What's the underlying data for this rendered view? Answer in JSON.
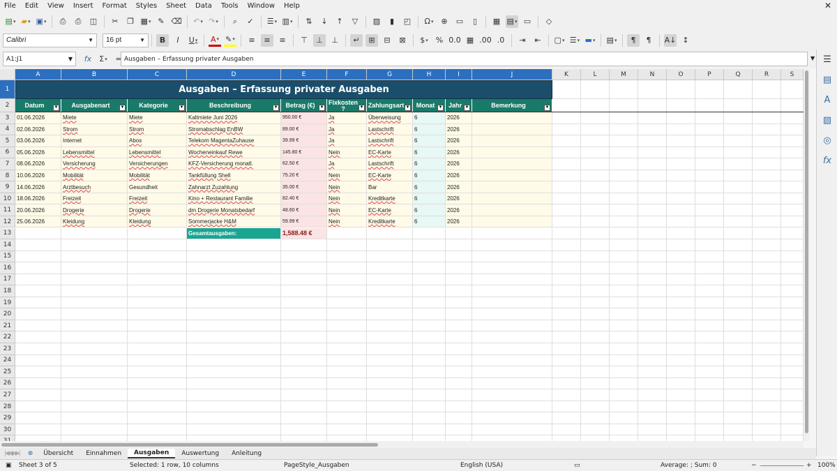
{
  "menu": [
    "File",
    "Edit",
    "View",
    "Insert",
    "Format",
    "Styles",
    "Sheet",
    "Data",
    "Tools",
    "Window",
    "Help"
  ],
  "font": {
    "name": "Calibri",
    "size": "16 pt"
  },
  "namebox": "A1:J1",
  "formula": "Ausgaben – Erfassung privater Ausgaben",
  "columns": [
    "A",
    "B",
    "C",
    "D",
    "E",
    "F",
    "G",
    "H",
    "I",
    "J",
    "K",
    "L",
    "M",
    "N",
    "O",
    "P",
    "Q",
    "R",
    "S"
  ],
  "title": "Ausgaben – Erfassung privater Ausgaben",
  "headers": [
    "Datum",
    "Ausgabenart",
    "Kategorie",
    "Beschreibung",
    "Betrag (€)",
    "Fixkosten ?",
    "Zahlungsart",
    "Monat",
    "Jahr",
    "Bemerkung"
  ],
  "rows": [
    [
      "01.06.2026",
      "Miete",
      "Miete",
      "Kaltmiete Juni 2026",
      "950.00 €",
      "Ja",
      "Überweisung",
      "6",
      "2026",
      ""
    ],
    [
      "02.06.2026",
      "Strom",
      "Strom",
      "Stromabschlag EnBW",
      "89.00 €",
      "Ja",
      "Lastschrift",
      "6",
      "2026",
      ""
    ],
    [
      "03.06.2026",
      "Internet",
      "Abos",
      "Telekom MagentaZuhause",
      "39.99 €",
      "Ja",
      "Lastschrift",
      "6",
      "2026",
      ""
    ],
    [
      "05.06.2026",
      "Lebensmittel",
      "Lebensmittel",
      "Wocheneinkauf Rewe",
      "145.80 €",
      "Nein",
      "EC-Karte",
      "6",
      "2026",
      ""
    ],
    [
      "08.06.2026",
      "Versicherung",
      "Versicherungen",
      "KFZ-Versicherung monatl.",
      "62.50 €",
      "Ja",
      "Lastschrift",
      "6",
      "2026",
      ""
    ],
    [
      "10.06.2026",
      "Mobilität",
      "Mobilität",
      "Tankfüllung Shell",
      "75.20 €",
      "Nein",
      "EC-Karte",
      "6",
      "2026",
      ""
    ],
    [
      "14.06.2026",
      "Arztbesuch",
      "Gesundheit",
      "Zahnarzt Zuzahlung",
      "35.00 €",
      "Nein",
      "Bar",
      "6",
      "2026",
      ""
    ],
    [
      "18.06.2026",
      "Freizeit",
      "Freizeit",
      "Kino + Restaurant Familie",
      "82.40 €",
      "Nein",
      "Kreditkarte",
      "6",
      "2026",
      ""
    ],
    [
      "20.06.2026",
      "Drogerie",
      "Drogerie",
      "dm Drogerie Monatsbedarf",
      "48.60 €",
      "Nein",
      "EC-Karte",
      "6",
      "2026",
      ""
    ],
    [
      "25.06.2026",
      "Kleidung",
      "Kleidung",
      "Sommerjacke H&M",
      "59.99 €",
      "Nein",
      "Kreditkarte",
      "6",
      "2026",
      ""
    ]
  ],
  "total_label": "Gesamtausgaben:",
  "total_value": "1,588.48 €",
  "sheets": [
    "Übersicht",
    "Einnahmen",
    "Ausgaben",
    "Auswertung",
    "Anleitung"
  ],
  "active_sheet": "Ausgaben",
  "status": {
    "sheet": "Sheet 3 of 5",
    "selection": "Selected: 1 row, 10 columns",
    "pagestyle": "PageStyle_Ausgaben",
    "lang": "English (USA)",
    "sum": "Average: ; Sum: 0",
    "zoom": "100%"
  },
  "colors": {
    "title_bg": "#1b4e6b",
    "header_bg": "#1a7a6a",
    "total_bg": "#1aa592",
    "selection": "#2d6fbf"
  }
}
